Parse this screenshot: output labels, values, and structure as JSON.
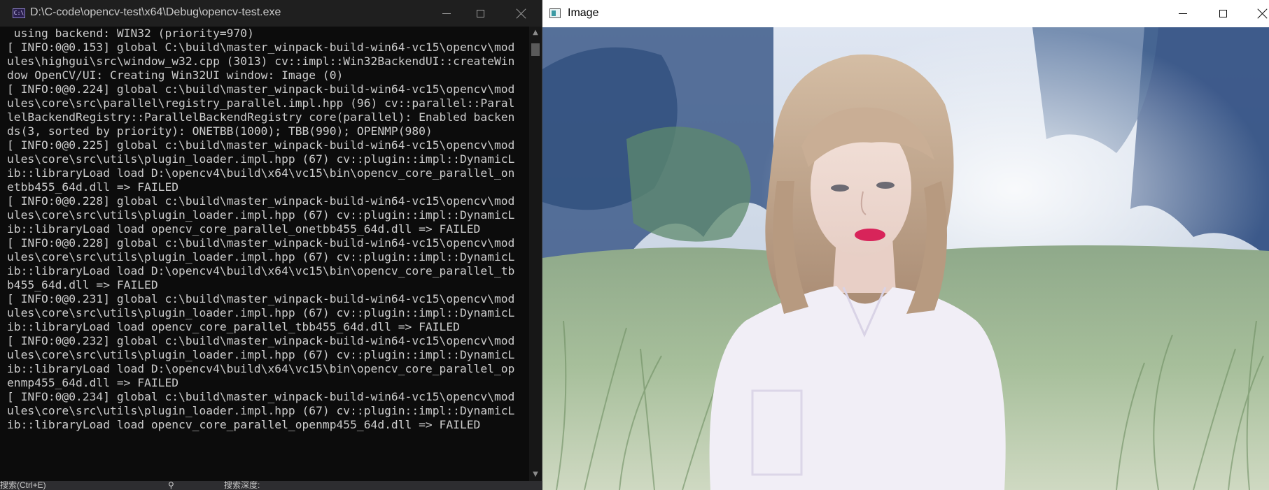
{
  "console": {
    "title": "D:\\C-code\\opencv-test\\x64\\Debug\\opencv-test.exe",
    "icon": "console-app-icon",
    "icon_glyph": "C:\\",
    "lines": [
      " using backend: WIN32 (priority=970)",
      "[ INFO:0@0.153] global C:\\build\\master_winpack-build-win64-vc15\\opencv\\mod",
      "ules\\highgui\\src\\window_w32.cpp (3013) cv::impl::Win32BackendUI::createWin",
      "dow OpenCV/UI: Creating Win32UI window: Image (0)",
      "[ INFO:0@0.224] global c:\\build\\master_winpack-build-win64-vc15\\opencv\\mod",
      "ules\\core\\src\\parallel\\registry_parallel.impl.hpp (96) cv::parallel::Paral",
      "lelBackendRegistry::ParallelBackendRegistry core(parallel): Enabled backen",
      "ds(3, sorted by priority): ONETBB(1000); TBB(990); OPENMP(980)",
      "[ INFO:0@0.225] global c:\\build\\master_winpack-build-win64-vc15\\opencv\\mod",
      "ules\\core\\src\\utils\\plugin_loader.impl.hpp (67) cv::plugin::impl::DynamicL",
      "ib::libraryLoad load D:\\opencv4\\build\\x64\\vc15\\bin\\opencv_core_parallel_on",
      "etbb455_64d.dll => FAILED",
      "[ INFO:0@0.228] global c:\\build\\master_winpack-build-win64-vc15\\opencv\\mod",
      "ules\\core\\src\\utils\\plugin_loader.impl.hpp (67) cv::plugin::impl::DynamicL",
      "ib::libraryLoad load opencv_core_parallel_onetbb455_64d.dll => FAILED",
      "[ INFO:0@0.228] global c:\\build\\master_winpack-build-win64-vc15\\opencv\\mod",
      "ules\\core\\src\\utils\\plugin_loader.impl.hpp (67) cv::plugin::impl::DynamicL",
      "ib::libraryLoad load D:\\opencv4\\build\\x64\\vc15\\bin\\opencv_core_parallel_tb",
      "b455_64d.dll => FAILED",
      "[ INFO:0@0.231] global c:\\build\\master_winpack-build-win64-vc15\\opencv\\mod",
      "ules\\core\\src\\utils\\plugin_loader.impl.hpp (67) cv::plugin::impl::DynamicL",
      "ib::libraryLoad load opencv_core_parallel_tbb455_64d.dll => FAILED",
      "[ INFO:0@0.232] global c:\\build\\master_winpack-build-win64-vc15\\opencv\\mod",
      "ules\\core\\src\\utils\\plugin_loader.impl.hpp (67) cv::plugin::impl::DynamicL",
      "ib::libraryLoad load D:\\opencv4\\build\\x64\\vc15\\bin\\opencv_core_parallel_op",
      "enmp455_64d.dll => FAILED",
      "[ INFO:0@0.234] global c:\\build\\master_winpack-build-win64-vc15\\opencv\\mod",
      "ules\\core\\src\\utils\\plugin_loader.impl.hpp (67) cv::plugin::impl::DynamicL",
      "ib::libraryLoad load opencv_core_parallel_openmp455_64d.dll => FAILED"
    ],
    "colors": {
      "background": "#0c0c0c",
      "text": "#cccccc",
      "titlebar": "#1f1f1f"
    }
  },
  "background_app": {
    "search_label": "搜索(Ctrl+E)",
    "depth_label": "搜索深度:"
  },
  "image_window": {
    "title": "Image",
    "icon": "opencv-image-window-icon",
    "content_icon": "photo-portrait-image",
    "colors": {
      "titlebar": "#ffffff",
      "shirt": "#f1eef6",
      "lips": "#d8245a"
    }
  },
  "window_controls": {
    "minimize_icon": "minimize-icon",
    "maximize_icon": "maximize-icon",
    "close_icon": "close-icon"
  }
}
